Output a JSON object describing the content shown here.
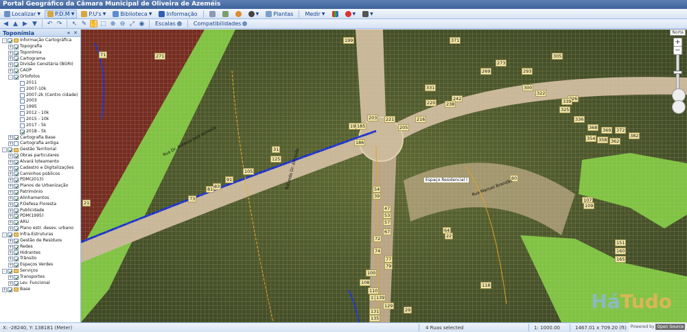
{
  "app": {
    "title": "Portal Geográfico da Câmara Municipal de Oliveira de Azeméis"
  },
  "menubar": {
    "localizar": "Localizar",
    "pdm": "P.D.M",
    "pus": "P.U's",
    "biblioteca": "Biblioteca",
    "informacao": "Informação",
    "plantas": "Plantas",
    "medir": "Medir"
  },
  "toolbar2": {
    "escalas": "Escalas",
    "compatibilidades": "Compatibilidades"
  },
  "sidebar": {
    "title": "Toponímia",
    "tree": [
      {
        "label": "Informação Cartográfica",
        "level": 0,
        "exp": "-",
        "chk": true,
        "folder": true
      },
      {
        "label": "Topografia",
        "level": 1,
        "exp": "+",
        "chk": true
      },
      {
        "label": "Toponímia",
        "level": 1,
        "exp": "+",
        "chk": true
      },
      {
        "label": "Cartograma",
        "level": 1,
        "exp": "+",
        "chk": true
      },
      {
        "label": "Divisão Censitária (BGRI)",
        "level": 1,
        "exp": "+",
        "chk": true
      },
      {
        "label": "CAOP",
        "level": 1,
        "exp": "+",
        "chk": true
      },
      {
        "label": "Ortofotos",
        "level": 1,
        "exp": "-",
        "chk": true
      },
      {
        "label": "2011",
        "level": 2,
        "chk": false
      },
      {
        "label": "2007-10k",
        "level": 2,
        "chk": false
      },
      {
        "label": "2007-2k (Centro cidade)",
        "level": 2,
        "chk": false
      },
      {
        "label": "2003",
        "level": 2,
        "chk": false
      },
      {
        "label": "1995",
        "level": 2,
        "chk": false
      },
      {
        "label": "2012 - 10k",
        "level": 2,
        "chk": false
      },
      {
        "label": "2015 - 10k",
        "level": 2,
        "chk": false
      },
      {
        "label": "2017 - 5k",
        "level": 2,
        "chk": false
      },
      {
        "label": "2018 - 5k",
        "level": 2,
        "chk": true
      },
      {
        "label": "Cartografia Base",
        "level": 1,
        "exp": "+",
        "chk": true
      },
      {
        "label": "Cartografia antiga",
        "level": 1,
        "exp": "+",
        "chk": false
      },
      {
        "label": "Gestão Territorial",
        "level": 0,
        "exp": "-",
        "chk": true,
        "folder": true
      },
      {
        "label": "Obras particulares",
        "level": 1,
        "exp": "+",
        "chk": true
      },
      {
        "label": "Alvará loteamento",
        "level": 1,
        "exp": "+",
        "chk": true
      },
      {
        "label": "Cadastro e Digitalizações",
        "level": 1,
        "exp": "+",
        "chk": true
      },
      {
        "label": "Caminhos públicos",
        "level": 1,
        "exp": "+",
        "chk": true
      },
      {
        "label": "PDM(2013)",
        "level": 1,
        "exp": "+",
        "chk": true
      },
      {
        "label": "Planos de Urbanização",
        "level": 1,
        "exp": "+",
        "chk": true
      },
      {
        "label": "Património",
        "level": 1,
        "exp": "+",
        "chk": true
      },
      {
        "label": "Alinhamentos",
        "level": 1,
        "exp": "+",
        "chk": true
      },
      {
        "label": "P.Defesa Floresta",
        "level": 1,
        "exp": "+",
        "chk": true
      },
      {
        "label": "Publicidade",
        "level": 1,
        "exp": "+",
        "chk": true
      },
      {
        "label": "PDM(1995)",
        "level": 1,
        "exp": "+",
        "chk": true
      },
      {
        "label": "ARU",
        "level": 1,
        "exp": "+",
        "chk": true
      },
      {
        "label": "Plano estr. desev. urbano",
        "level": 1,
        "exp": "+",
        "chk": true
      },
      {
        "label": "Infra-Estruturas",
        "level": 0,
        "exp": "-",
        "chk": true,
        "folder": true
      },
      {
        "label": "Gestão de Resíduos",
        "level": 1,
        "exp": "+",
        "chk": true
      },
      {
        "label": "Redes",
        "level": 1,
        "exp": "+",
        "chk": true
      },
      {
        "label": "Hidrantes",
        "level": 1,
        "exp": "+",
        "chk": true
      },
      {
        "label": "Trânsito",
        "level": 1,
        "exp": "+",
        "chk": true
      },
      {
        "label": "Espaços Verdes",
        "level": 1,
        "exp": "+",
        "chk": true
      },
      {
        "label": "Serviços",
        "level": 0,
        "exp": "-",
        "chk": true,
        "folder": true
      },
      {
        "label": "Transportes",
        "level": 1,
        "exp": "+",
        "chk": true
      },
      {
        "label": "Lev. Funcional",
        "level": 1,
        "exp": "+",
        "chk": true
      },
      {
        "label": "Base",
        "level": 0,
        "exp": "+",
        "chk": true,
        "folder": true
      }
    ]
  },
  "map": {
    "north_label": "Norte",
    "zoom_in": "+",
    "zoom_out": "−",
    "area_label": "Espaço Residencial I",
    "road_labels": [
      "Rua Dr. António José Almeida",
      "Rotunda Dr. Almeida",
      "Rua Manuel Brandão"
    ],
    "house_numbers": [
      "199",
      "371",
      "71",
      "271",
      "305",
      "269",
      "273",
      "293",
      "331",
      "300",
      "322",
      "325",
      "326",
      "336",
      "368",
      "369",
      "372",
      "382",
      "354",
      "358",
      "362",
      "339",
      "220",
      "242",
      "238",
      "216",
      "221",
      "203",
      "205",
      "195",
      "185",
      "186",
      "31",
      "125",
      "105",
      "91",
      "83",
      "81",
      "73",
      "21",
      "54",
      "39",
      "47",
      "53",
      "57",
      "67",
      "72",
      "74",
      "77",
      "79",
      "100",
      "108",
      "110",
      "112",
      "118",
      "129",
      "131",
      "135",
      "139",
      "60",
      "107",
      "109",
      "151",
      "160",
      "165",
      "64",
      "22",
      "29"
    ],
    "watermark_a": "Há",
    "watermark_b": "Tudo"
  },
  "statusbar": {
    "coords": "X: -28240, Y: 138181 (Meter)",
    "selected": "4 Ruas selected",
    "scale": "1: 1000.00",
    "extent": "1467.01 x 709.20 (ft)",
    "powered_by": "Powered by",
    "opensource": "Open Source"
  }
}
